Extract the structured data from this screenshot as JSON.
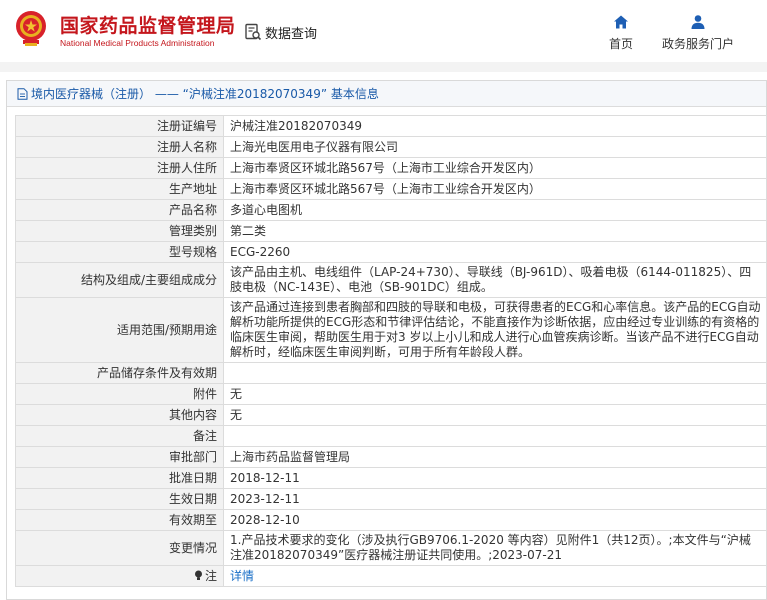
{
  "header": {
    "brand_cn": "国家药品监督管理局",
    "brand_en": "National Medical Products Administration",
    "query_label": "数据查询",
    "nav_home": "首页",
    "nav_portal": "政务服务门户"
  },
  "panel": {
    "title": "境内医疗器械（注册） —— “沪械注准20182070349” 基本信息"
  },
  "rows": [
    {
      "key": "注册证编号",
      "value": "沪械注准20182070349"
    },
    {
      "key": "注册人名称",
      "value": "上海光电医用电子仪器有限公司"
    },
    {
      "key": "注册人住所",
      "value": "上海市奉贤区环城北路567号（上海市工业综合开发区内）"
    },
    {
      "key": "生产地址",
      "value": "上海市奉贤区环城北路567号（上海市工业综合开发区内）"
    },
    {
      "key": "产品名称",
      "value": "多道心电图机"
    },
    {
      "key": "管理类别",
      "value": "第二类"
    },
    {
      "key": "型号规格",
      "value": "ECG-2260"
    },
    {
      "key": "结构及组成/主要组成成分",
      "value": "该产品由主机、电线组件（LAP-24+730）、导联线（BJ-961D）、吸着电极（6144-011825）、四肢电极（NC-143E）、电池（SB-901DC）组成。"
    },
    {
      "key": "适用范围/预期用途",
      "value": "该产品通过连接到患者胸部和四肢的导联和电极，可获得患者的ECG和心率信息。该产品的ECG自动解析功能所提供的ECG形态和节律评估结论，不能直接作为诊断依据，应由经过专业训练的有资格的临床医生审阅，帮助医生用于对3 岁以上小儿和成人进行心血管疾病诊断。当该产品不进行ECG自动解析时，经临床医生审阅判断，可用于所有年龄段人群。"
    },
    {
      "key": "产品储存条件及有效期",
      "value": ""
    },
    {
      "key": "附件",
      "value": "无"
    },
    {
      "key": "其他内容",
      "value": "无"
    },
    {
      "key": "备注",
      "value": ""
    },
    {
      "key": "审批部门",
      "value": "上海市药品监督管理局"
    },
    {
      "key": "批准日期",
      "value": "2018-12-11"
    },
    {
      "key": "生效日期",
      "value": "2023-12-11"
    },
    {
      "key": "有效期至",
      "value": "2028-12-10"
    },
    {
      "key": "变更情况",
      "value": "1.产品技术要求的变化（涉及执行GB9706.1-2020 等内容）见附件1（共12页）。;本文件与“沪械注准20182070349”医疗器械注册证共同使用。;2023-07-21"
    },
    {
      "key": "注",
      "value": "详情"
    }
  ],
  "colors": {
    "brand_red": "#c4161c",
    "link_blue": "#1a6fc7",
    "title_blue": "#1a5aa8",
    "nav_icon_blue": "#1e5fb4"
  },
  "icons": [
    "national-emblem-icon",
    "search-document-icon",
    "home-icon",
    "user-icon",
    "document-icon",
    "lightbulb-icon"
  ]
}
